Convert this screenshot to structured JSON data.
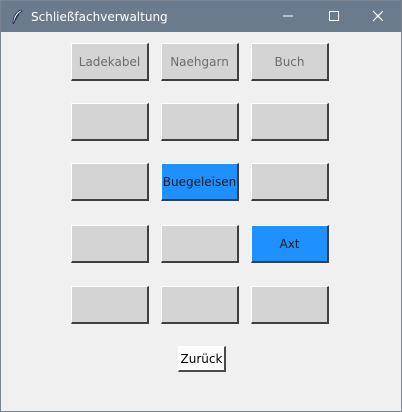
{
  "window": {
    "title": "Schließfachverwaltung",
    "titlebar_color": "#6b7b8e"
  },
  "titlebar_controls": {
    "minimize_icon": "minimize-icon",
    "maximize_icon": "maximize-icon",
    "close_icon": "close-icon"
  },
  "lockers": [
    {
      "label": "Ladekabel",
      "occupied": false
    },
    {
      "label": "Naehgarn",
      "occupied": false
    },
    {
      "label": "Buch",
      "occupied": false
    },
    {
      "label": "",
      "occupied": false
    },
    {
      "label": "",
      "occupied": false
    },
    {
      "label": "",
      "occupied": false
    },
    {
      "label": "",
      "occupied": false
    },
    {
      "label": "Buegeleisen",
      "occupied": true
    },
    {
      "label": "",
      "occupied": false
    },
    {
      "label": "",
      "occupied": false
    },
    {
      "label": "",
      "occupied": false
    },
    {
      "label": "Axt",
      "occupied": true
    },
    {
      "label": "",
      "occupied": false
    },
    {
      "label": "",
      "occupied": false
    },
    {
      "label": "",
      "occupied": false
    }
  ],
  "colors": {
    "locker_default": "#d4d4d4",
    "locker_occupied": "#1e90ff"
  },
  "back_button": {
    "label": "Zurück"
  }
}
